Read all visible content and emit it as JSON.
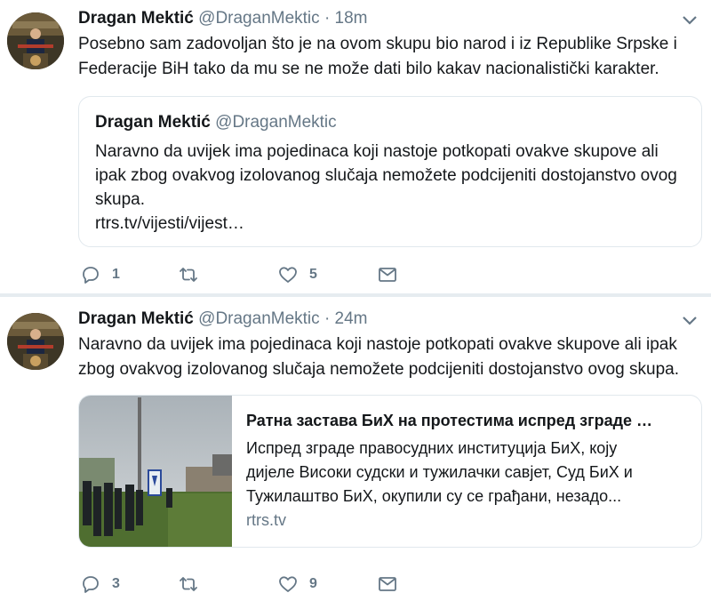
{
  "tweets": [
    {
      "name": "Dragan Mektić",
      "handle": "@DraganMektic",
      "separator": "·",
      "time": "18m",
      "text_lines": [
        "Posebno sam zadovoljan što je na ovom skupu bio narod i iz Republike Srpske i",
        "Federacije BiH tako da mu se ne može dati bilo kakav nacionalistički karakter."
      ],
      "quote": {
        "name": "Dragan Mektić",
        "handle": "@DraganMektic",
        "text_lines": [
          "Naravno da uvijek ima pojedinaca koji nastoje potkopati ovakve skupove ali",
          "ipak zbog ovakvog izolovanog slučaja nemožete podcijeniti dostojanstvo ovog",
          "skupa.",
          "rtrs.tv/vijesti/vijest…"
        ]
      },
      "actions": {
        "reply_count": "1",
        "retweet_count": "",
        "like_count": "5"
      }
    },
    {
      "name": "Dragan Mektić",
      "handle": "@DraganMektic",
      "separator": "·",
      "time": "24m",
      "text_lines": [
        "Naravno da uvijek ima pojedinaca koji nastoje potkopati ovakve skupove ali ipak",
        "zbog ovakvog izolovanog slučaja nemožete podcijeniti dostojanstvo ovog skupa."
      ],
      "card": {
        "title": "Ратна застава БиХ на протестима испред зграде …",
        "desc_lines": [
          "Испред зграде правосудних институција БиХ, коју",
          "дијеле Високи судски и тужилачки савјет, Суд БиХ и",
          "Тужилаштво БиХ, окупили су се грађани, незадо..."
        ],
        "domain": "rtrs.tv"
      },
      "actions": {
        "reply_count": "3",
        "retweet_count": "",
        "like_count": "9"
      }
    }
  ],
  "colors": {
    "text": "#14171a",
    "secondary": "#657786",
    "border": "#e1e8ed",
    "divider": "#e6ecf0"
  },
  "icons": [
    "chevron-down-icon",
    "reply-icon",
    "retweet-icon",
    "like-icon",
    "message-icon"
  ]
}
